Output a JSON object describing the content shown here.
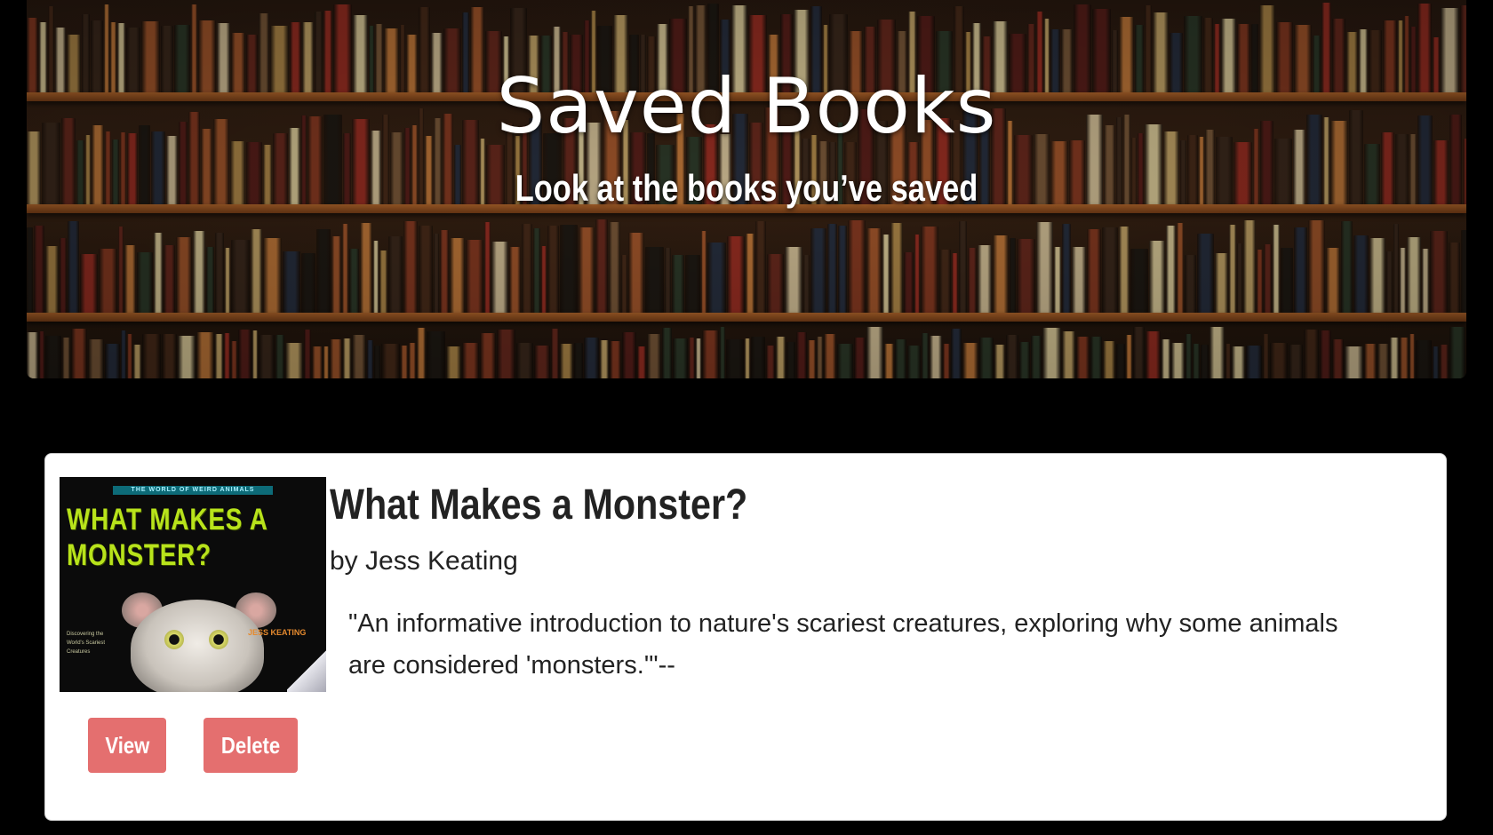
{
  "header": {
    "title": "Saved Books",
    "subtitle": "Look at the books you’ve saved"
  },
  "book": {
    "title": "What Makes a Monster?",
    "author": "by Jess Keating",
    "description": "\"An informative introduction to nature's scariest creatures, exploring why some animals are considered 'monsters.'\"--",
    "cover": {
      "series": "THE WORLD OF WEIRD ANIMALS",
      "title_line1": "WHAT MAKES A",
      "title_line2": "MONSTER?",
      "author": "JESS KEATING",
      "side_text": "Discovering the World's Scariest Creatures"
    }
  },
  "actions": {
    "view_label": "View",
    "delete_label": "Delete"
  },
  "colors": {
    "background": "#000000",
    "card": "#ffffff",
    "button": "#e46f6f",
    "cover_title": "#b8e31b"
  }
}
